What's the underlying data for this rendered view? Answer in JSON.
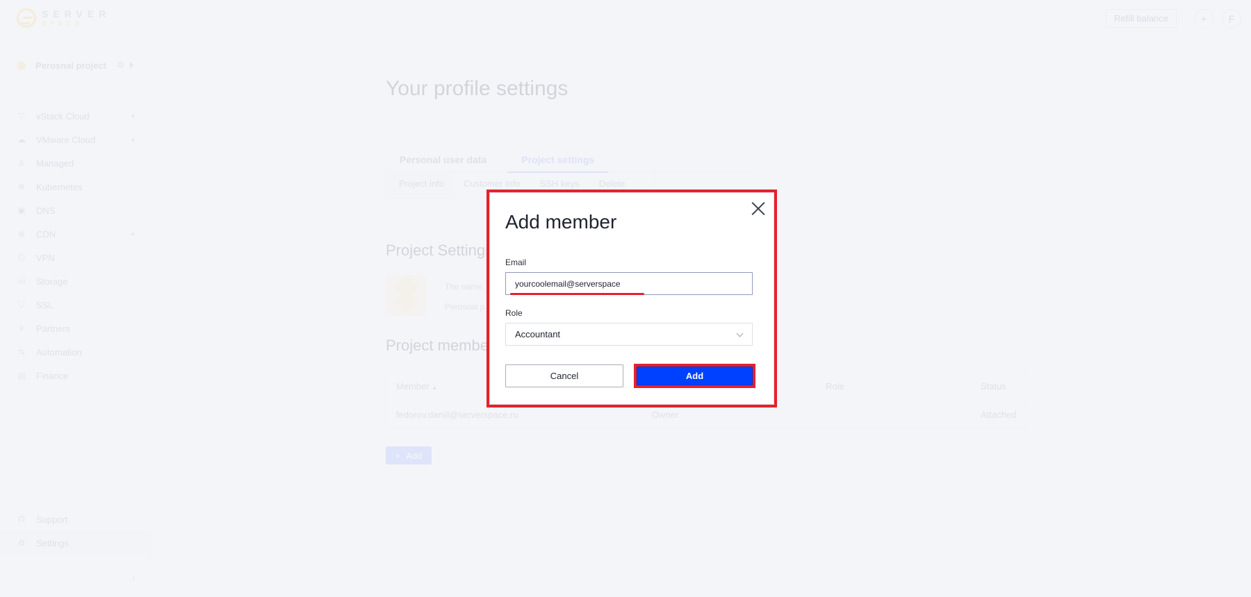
{
  "app": {
    "logo_line1": "SERVER",
    "logo_line2": "SPACE",
    "refill_label": "Refill balance",
    "add_icon": "+",
    "user_initial": "F"
  },
  "sidebar": {
    "project_name": "Perosnal project",
    "items": [
      {
        "label": "vStack Cloud",
        "icon": "▽",
        "expandable": true
      },
      {
        "label": "VMware Cloud",
        "icon": "☁",
        "expandable": true
      },
      {
        "label": "Managed",
        "icon": "♙",
        "expandable": false
      },
      {
        "label": "Kubernetes",
        "icon": "✲",
        "expandable": false
      },
      {
        "label": "DNS",
        "icon": "▣",
        "expandable": false
      },
      {
        "label": "CDN",
        "icon": "⊕",
        "expandable": true
      },
      {
        "label": "VPN",
        "icon": "⬡",
        "expandable": false
      },
      {
        "label": "Storage",
        "icon": "⛁",
        "expandable": false
      },
      {
        "label": "SSL",
        "icon": "⛉",
        "expandable": false
      },
      {
        "label": "Partners",
        "icon": "✳",
        "expandable": false
      },
      {
        "label": "Automation",
        "icon": "⇆",
        "expandable": false
      },
      {
        "label": "Finance",
        "icon": "▤",
        "expandable": false
      }
    ],
    "bottom_items": [
      {
        "label": "Support",
        "icon": "☊"
      },
      {
        "label": "Settings",
        "icon": "⚙",
        "active": true
      }
    ]
  },
  "main": {
    "title": "Your profile settings",
    "tabs": [
      "Personal user data",
      "Project settings"
    ],
    "active_tab": "Project settings",
    "subtabs": [
      "Project info",
      "Customer Info",
      "SSH keys",
      "Delete"
    ],
    "active_subtab": "Project info",
    "project_settings_title": "Project Settings",
    "project_name_label": "The name",
    "project_name_value": "Perosnal p",
    "members_title": "Project members",
    "table": {
      "columns": [
        "Member",
        "Role",
        "Status"
      ],
      "rows": [
        {
          "member": "fedorov.daniil@serverspace.ru",
          "role": "Owner",
          "status": "Attached",
          "menu": "···"
        }
      ]
    },
    "add_label": "Add"
  },
  "modal": {
    "title": "Add member",
    "email_label": "Email",
    "email_value": "yourcoolemail@serverspace",
    "role_label": "Role",
    "role_value": "Accountant",
    "cancel_label": "Cancel",
    "add_label": "Add",
    "annotation_color": "#e8202a",
    "primary_color": "#0040ff"
  }
}
